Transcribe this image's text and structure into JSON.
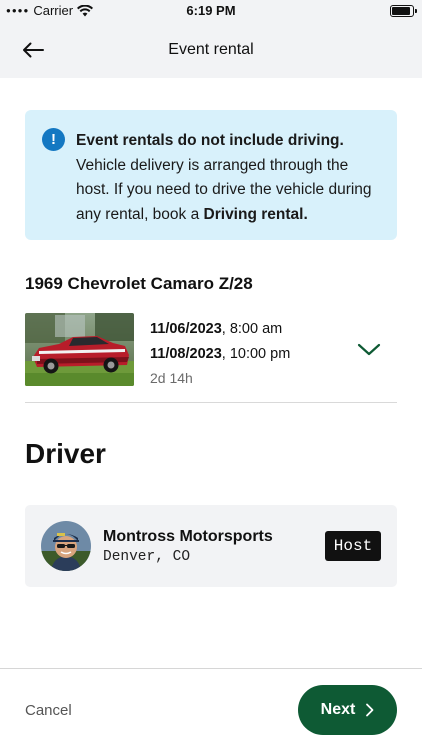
{
  "status_bar": {
    "carrier": "Carrier",
    "time": "6:19 PM"
  },
  "nav": {
    "title": "Event rental",
    "back_icon": "arrow-left-icon"
  },
  "alert": {
    "icon": "info-icon",
    "icon_glyph": "!",
    "heading": "Event rentals do not include driving.",
    "body_before": " Vehicle delivery is arranged through the host. If you need to drive the vehicle during any rental, book a ",
    "body_link": "Driving rental.",
    "color_bg": "#d8f1fb",
    "color_icon": "#1478c2"
  },
  "vehicle": {
    "name": "1969 Chevrolet Camaro Z/28",
    "start_date": "11/06/2023",
    "start_time": ", 8:00 am",
    "end_date": "11/08/2023",
    "end_time": ", 10:00 pm",
    "duration": "2d 14h"
  },
  "driver_section": {
    "title": "Driver",
    "name": "Montross Motorsports",
    "location": "Denver, CO",
    "badge": "Host"
  },
  "footer": {
    "cancel_label": "Cancel",
    "next_label": "Next",
    "next_color": "#0e5a34"
  }
}
